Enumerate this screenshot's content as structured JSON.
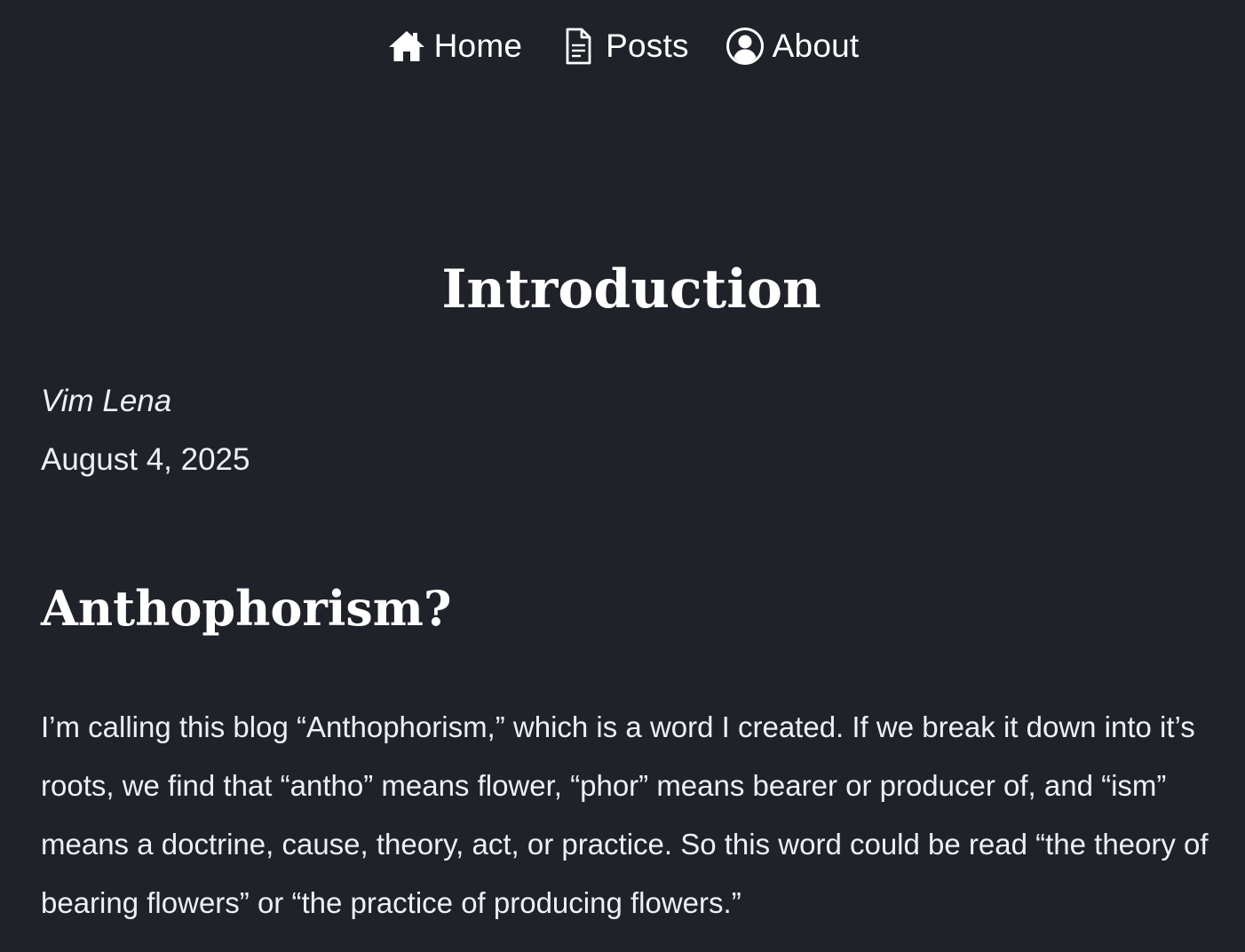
{
  "nav": {
    "items": [
      {
        "label": "Home",
        "icon": "home-icon"
      },
      {
        "label": "Posts",
        "icon": "document-icon"
      },
      {
        "label": "About",
        "icon": "user-circle-icon"
      }
    ]
  },
  "post": {
    "title": "Introduction",
    "author": "Vim Lena",
    "date": "August 4, 2025",
    "sections": [
      {
        "heading": "Anthophorism?",
        "body": "I’m calling this blog “Anthophorism,” which is a word I created. If we break it down into it’s roots, we find that “antho” means flower, “phor” means bearer or producer of, and “ism” means a doctrine, cause, theory, act, or practice. So this word could be read “the theory of bearing flowers” or “the practice of producing flowers.”"
      }
    ]
  },
  "colors": {
    "background": "#20222a",
    "text": "#eef0f3",
    "heading": "#ffffff"
  }
}
